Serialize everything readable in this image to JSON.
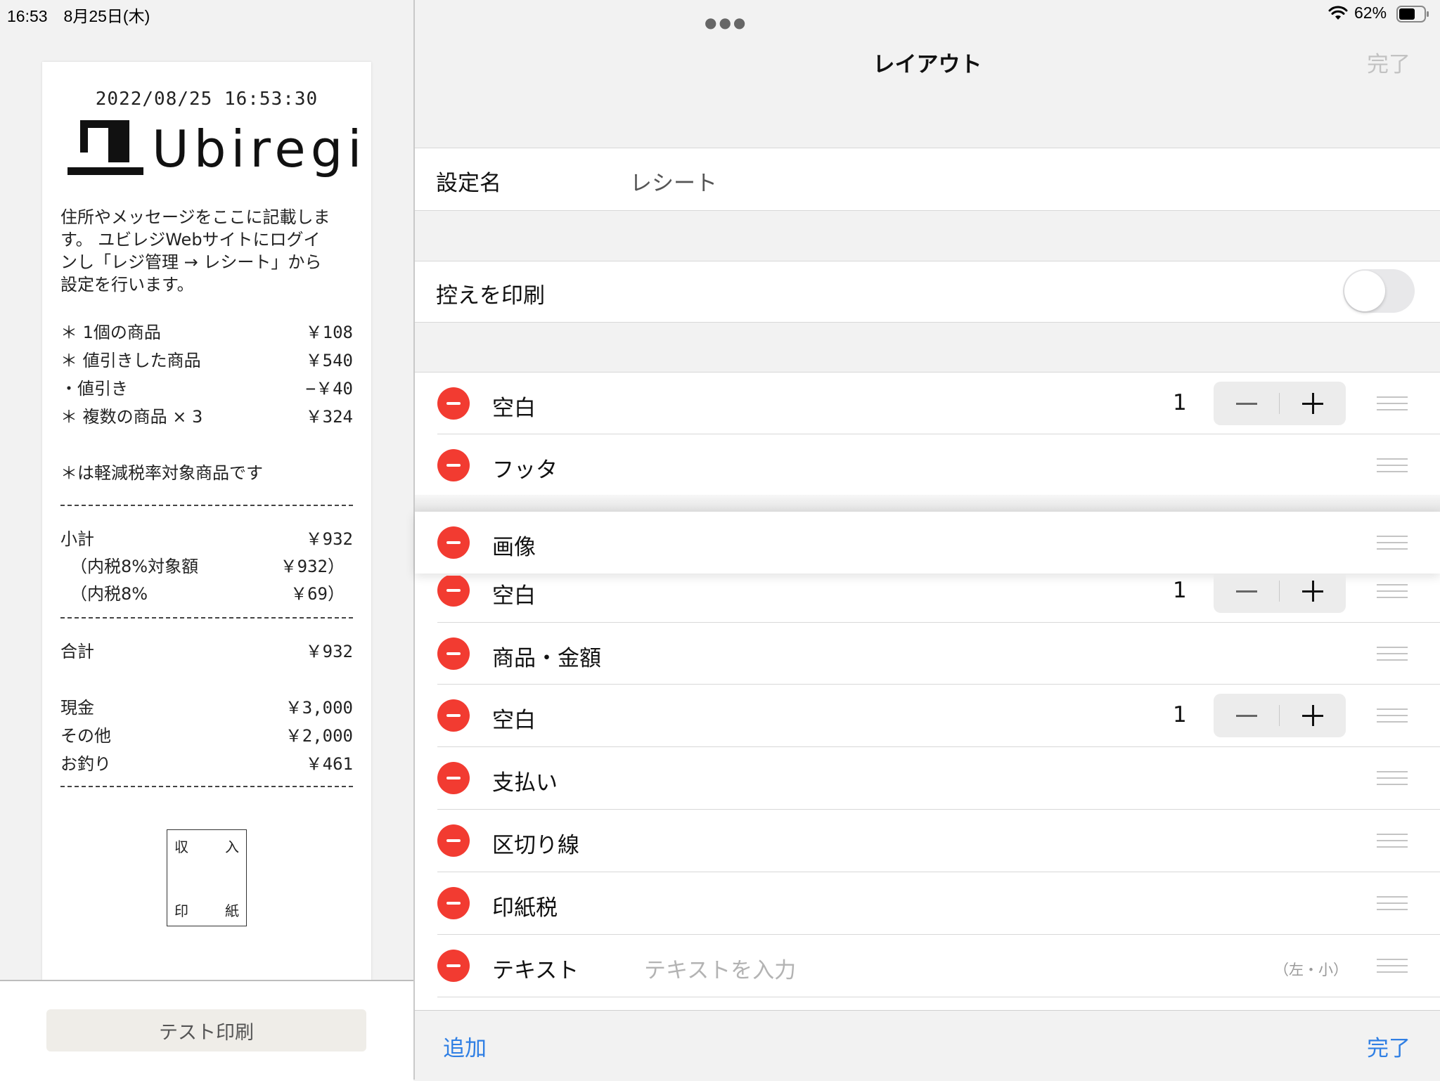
{
  "status_bar": {
    "time_date": "16:53　8月25日(木)",
    "battery": "62%"
  },
  "receipt": {
    "timestamp": "2022/08/25 16:53:30",
    "logo_text": "Ubiregi",
    "message": [
      "住所やメッセージをここに記載しま",
      "す。 ユビレジWebサイトにログイ",
      "ンし「レジ管理 → レシート」から",
      "設定を行います。"
    ],
    "items": [
      {
        "name": "＊ 1個の商品",
        "price": "￥108"
      },
      {
        "name": "＊ 値引きした商品",
        "price": "￥540"
      },
      {
        "name": "・値引き",
        "price": "−￥40"
      },
      {
        "name": "＊ 複数の商品 × 3",
        "price": "￥324"
      }
    ],
    "note": "＊は軽減税率対象商品です",
    "subtotal": [
      {
        "label": "小計",
        "value": "￥932"
      },
      {
        "label": "（内税8%対象額",
        "value": "￥932）"
      },
      {
        "label": "（内税8%",
        "value": "￥69）"
      }
    ],
    "total": {
      "label": "合計",
      "value": "￥932"
    },
    "payments": [
      {
        "label": "現金",
        "value": "￥3,000"
      },
      {
        "label": "その他",
        "value": "￥2,000"
      },
      {
        "label": "お釣り",
        "value": "￥461"
      }
    ],
    "stamp": {
      "tl": "収",
      "tr": "入",
      "bl": "印",
      "br": "紙"
    }
  },
  "test_print_label": "テスト印刷",
  "nav": {
    "title": "レイアウト",
    "done_label": "完了"
  },
  "settings": {
    "name_label": "設定名",
    "name_value": "レシート",
    "print_copy_label": "控えを印刷",
    "print_copy_on": false
  },
  "layout_items": [
    {
      "label": "空白",
      "count": "1"
    },
    {
      "label": "フッタ"
    },
    {
      "label": "画像"
    },
    {
      "label": "空白",
      "count": "1"
    },
    {
      "label": "商品・金額"
    },
    {
      "label": "空白",
      "count": "1"
    },
    {
      "label": "支払い"
    },
    {
      "label": "区切り線"
    },
    {
      "label": "印紙税"
    },
    {
      "label": "テキスト",
      "placeholder": "テキストを入力",
      "format": "（左・小）"
    }
  ],
  "footer": {
    "add_label": "追加",
    "done_label": "完了"
  },
  "colors": {
    "delete_red": "#f23b31",
    "link_blue": "#2f7fe4",
    "disabled_gray": "#c2c2c2"
  },
  "icons": [
    "wifi-icon",
    "battery-icon",
    "minus-circle-icon",
    "plus-icon",
    "minus-icon",
    "drag-handle-icon",
    "multitasking-dots-icon"
  ]
}
